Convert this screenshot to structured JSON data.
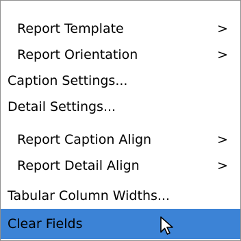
{
  "menu": {
    "items": [
      {
        "label": "Report Template",
        "arrow": ">"
      },
      {
        "label": "Report Orientation",
        "arrow": ">"
      },
      {
        "label": "Caption Settings..."
      },
      {
        "label": "Detail Settings..."
      },
      {
        "label": "Report Caption Align",
        "arrow": ">"
      },
      {
        "label": "Report Detail Align",
        "arrow": ">"
      },
      {
        "label": "Tabular Column Widths..."
      },
      {
        "label": "Clear Fields"
      }
    ],
    "highlight_color": "#3c83d6"
  }
}
